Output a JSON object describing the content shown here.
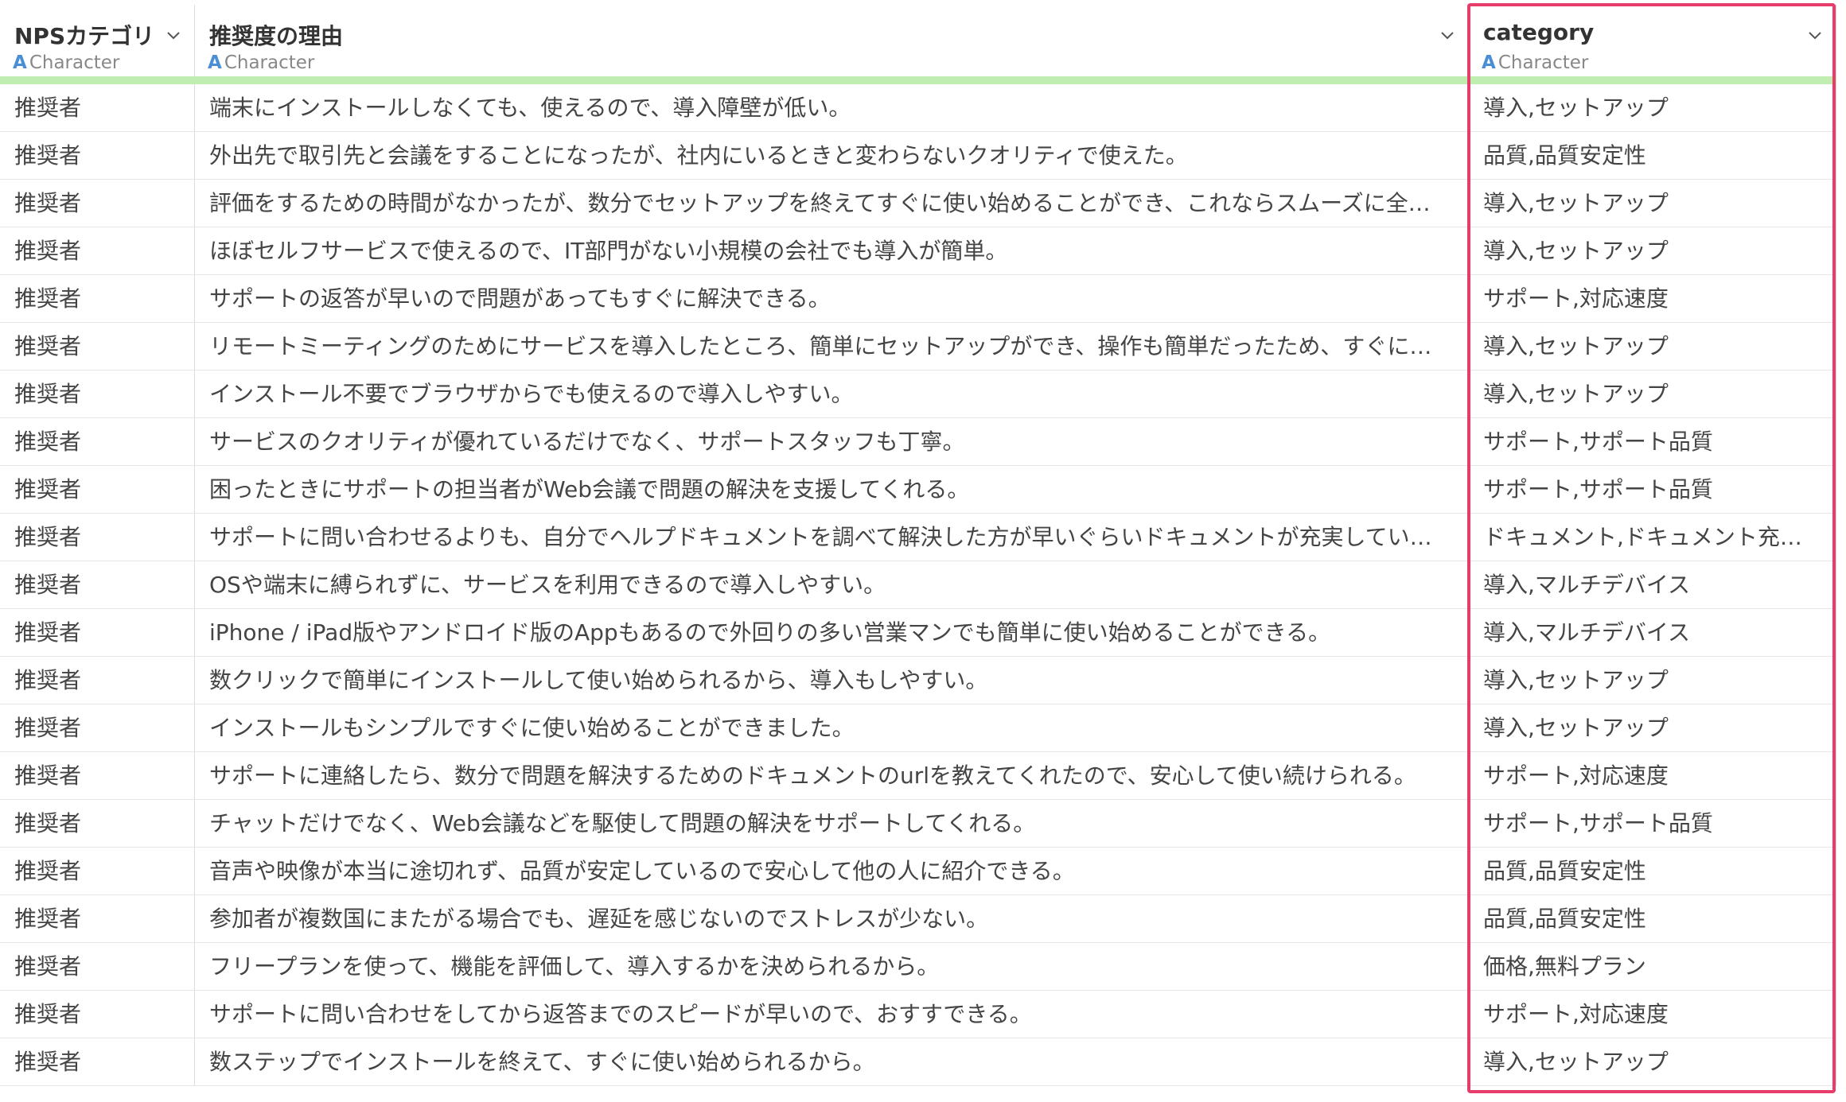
{
  "columns": [
    {
      "name": "NPSカテゴリ",
      "type": "Character"
    },
    {
      "name": "推奨度の理由",
      "type": "Character"
    },
    {
      "name": "category",
      "type": "Character"
    }
  ],
  "rows": [
    [
      "推奨者",
      "端末にインストールしなくても、使えるので、導入障壁が低い。",
      "導入,セットアップ"
    ],
    [
      "推奨者",
      "外出先で取引先と会議をすることになったが、社内にいるときと変わらないクオリティで使えた。",
      "品質,品質安定性"
    ],
    [
      "推奨者",
      "評価をするための時間がなかったが、数分でセットアップを終えてすぐに使い始めることができ、これならスムーズに全…",
      "導入,セットアップ"
    ],
    [
      "推奨者",
      "ほぼセルフサービスで使えるので、IT部門がない小規模の会社でも導入が簡単。",
      "導入,セットアップ"
    ],
    [
      "推奨者",
      "サポートの返答が早いので問題があってもすぐに解決できる。",
      "サポート,対応速度"
    ],
    [
      "推奨者",
      "リモートミーティングのためにサービスを導入したところ、簡単にセットアップができ、操作も簡単だったため、すぐに…",
      "導入,セットアップ"
    ],
    [
      "推奨者",
      "インストール不要でブラウザからでも使えるので導入しやすい。",
      "導入,セットアップ"
    ],
    [
      "推奨者",
      "サービスのクオリティが優れているだけでなく、サポートスタッフも丁寧。",
      "サポート,サポート品質"
    ],
    [
      "推奨者",
      "困ったときにサポートの担当者がWeb会議で問題の解決を支援してくれる。",
      "サポート,サポート品質"
    ],
    [
      "推奨者",
      "サポートに問い合わせるよりも、自分でヘルプドキュメントを調べて解決した方が早いぐらいドキュメントが充実してい…",
      "ドキュメント,ドキュメント充実度"
    ],
    [
      "推奨者",
      "OSや端末に縛られずに、サービスを利用できるので導入しやすい。",
      "導入,マルチデバイス"
    ],
    [
      "推奨者",
      "iPhone / iPad版やアンドロイド版のAppもあるので外回りの多い営業マンでも簡単に使い始めることができる。",
      "導入,マルチデバイス"
    ],
    [
      "推奨者",
      "数クリックで簡単にインストールして使い始められるから、導入もしやすい。",
      "導入,セットアップ"
    ],
    [
      "推奨者",
      "インストールもシンプルですぐに使い始めることができました。",
      "導入,セットアップ"
    ],
    [
      "推奨者",
      "サポートに連絡したら、数分で問題を解決するためのドキュメントのurlを教えてくれたので、安心して使い続けられる。",
      "サポート,対応速度"
    ],
    [
      "推奨者",
      "チャットだけでなく、Web会議などを駆使して問題の解決をサポートしてくれる。",
      "サポート,サポート品質"
    ],
    [
      "推奨者",
      "音声や映像が本当に途切れず、品質が安定しているので安心して他の人に紹介できる。",
      "品質,品質安定性"
    ],
    [
      "推奨者",
      "参加者が複数国にまたがる場合でも、遅延を感じないのでストレスが少ない。",
      "品質,品質安定性"
    ],
    [
      "推奨者",
      "フリープランを使って、機能を評価して、導入するかを決められるから。",
      "価格,無料プラン"
    ],
    [
      "推奨者",
      "サポートに問い合わせをしてから返答までのスピードが早いので、おすすできる。",
      "サポート,対応速度"
    ],
    [
      "推奨者",
      "数ステップでインストールを終えて、すぐに使い始められるから。",
      "導入,セットアップ"
    ]
  ]
}
